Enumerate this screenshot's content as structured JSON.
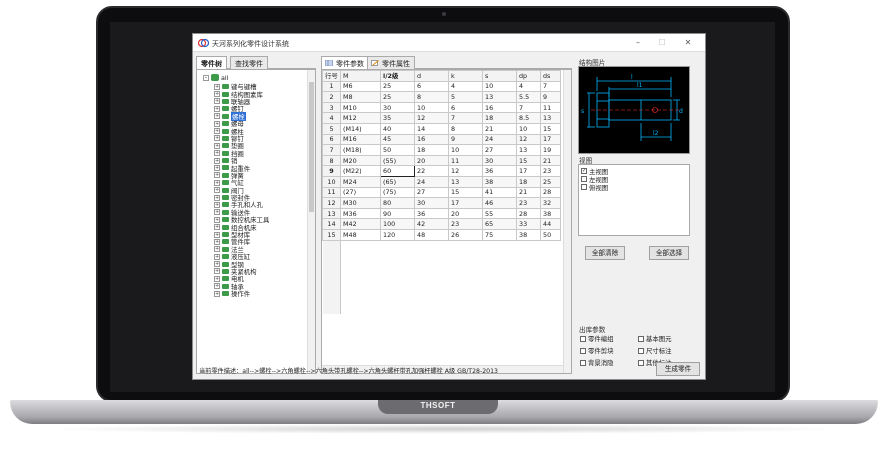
{
  "brand": "THSOFT",
  "window": {
    "title": "天河系列化零件设计系统",
    "minimize": "–",
    "maximize": "☐",
    "close": "✕"
  },
  "left_tabs": [
    "零件树",
    "查找零件"
  ],
  "tree": {
    "root": "all",
    "items": [
      "键与键槽",
      "结构图素库",
      "联轴器",
      "螺钉",
      "螺栓",
      "螺母",
      "螺柱",
      "铆钉",
      "垫圈",
      "挡圈",
      "销",
      "起重件",
      "弹簧",
      "气缸",
      "阀门",
      "密封件",
      "手孔和人孔",
      "输送件",
      "数控机床工具",
      "组合机床",
      "型材库",
      "管件库",
      "法兰",
      "液压缸",
      "型钢",
      "夹紧机构",
      "电机",
      "轴承",
      "操作件"
    ],
    "selected_index": 4
  },
  "mid_tabs": [
    "零件参数",
    "零件属性"
  ],
  "grid": {
    "headers": [
      "行号",
      "M",
      "l/2级",
      "d",
      "k",
      "s",
      "dp",
      "ds"
    ],
    "rows": [
      [
        "1",
        "M6",
        "25",
        "6",
        "4",
        "10",
        "4",
        "7"
      ],
      [
        "2",
        "M8",
        "25",
        "8",
        "5",
        "13",
        "5.5",
        "9"
      ],
      [
        "3",
        "M10",
        "30",
        "10",
        "6",
        "16",
        "7",
        "11"
      ],
      [
        "4",
        "M12",
        "35",
        "12",
        "7",
        "18",
        "8.5",
        "13"
      ],
      [
        "5",
        "(M14)",
        "40",
        "14",
        "8",
        "21",
        "10",
        "15"
      ],
      [
        "6",
        "M16",
        "45",
        "16",
        "9",
        "24",
        "12",
        "17"
      ],
      [
        "7",
        "(M18)",
        "50",
        "18",
        "10",
        "27",
        "13",
        "19"
      ],
      [
        "8",
        "M20",
        "(55)",
        "20",
        "11",
        "30",
        "15",
        "21"
      ],
      [
        "9",
        "(M22)",
        "60",
        "22",
        "12",
        "36",
        "17",
        "23"
      ],
      [
        "10",
        "M24",
        "(65)",
        "24",
        "13",
        "38",
        "18",
        "25"
      ],
      [
        "11",
        "(27)",
        "(75)",
        "27",
        "15",
        "41",
        "21",
        "28"
      ],
      [
        "12",
        "M30",
        "80",
        "30",
        "17",
        "46",
        "23",
        "32"
      ],
      [
        "13",
        "M36",
        "90",
        "36",
        "20",
        "55",
        "28",
        "38"
      ],
      [
        "14",
        "M42",
        "100",
        "42",
        "23",
        "65",
        "33",
        "44"
      ],
      [
        "15",
        "M48",
        "120",
        "48",
        "26",
        "75",
        "38",
        "50"
      ]
    ],
    "current_row": 9
  },
  "preview": {
    "label": "结构图片",
    "dims": [
      "d",
      "l",
      "s",
      "l1",
      "l2"
    ]
  },
  "views": {
    "label": "视图",
    "items": [
      "主视图",
      "左视图",
      "俯视图"
    ],
    "checked": [
      true,
      false,
      false
    ]
  },
  "buttons": {
    "clear_all": "全部清除",
    "select_all": "全部选择",
    "generate": "生成零件"
  },
  "output": {
    "label": "出库参数",
    "items": [
      "零件编组",
      "基本图元",
      "零件剪块",
      "尺寸标注",
      "背景消隐",
      "其他标注"
    ]
  },
  "status": {
    "text": "当前零件描述：all-->螺栓-->六角螺栓-->六角头带孔螺栓-->六角头螺杆带孔加强杆螺栓 A级 GB/T28-2013"
  },
  "colors": {
    "selection": "#2f6fd6",
    "tree_icon": "#3c9a4a",
    "drawing_lines": "#00b7ff",
    "drawing_center": "#ff3030"
  }
}
